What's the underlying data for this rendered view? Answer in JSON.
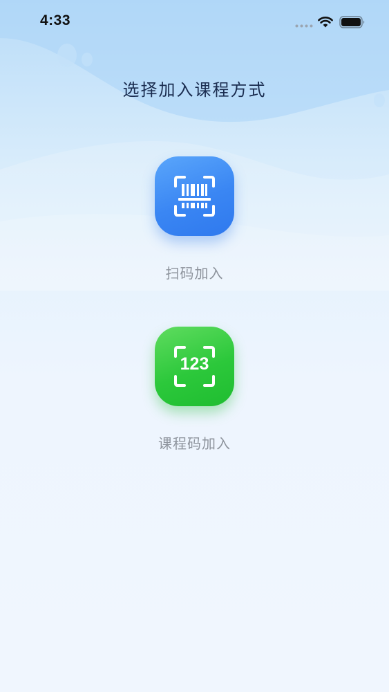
{
  "status_bar": {
    "time": "4:33"
  },
  "page": {
    "title": "选择加入课程方式"
  },
  "options": [
    {
      "id": "scan",
      "label": "扫码加入",
      "icon": "barcode-scan-icon",
      "color": "#3a86f3"
    },
    {
      "id": "code",
      "label": "课程码加入",
      "icon": "course-code-icon",
      "icon_text": "123",
      "color": "#2cc83b"
    }
  ]
}
